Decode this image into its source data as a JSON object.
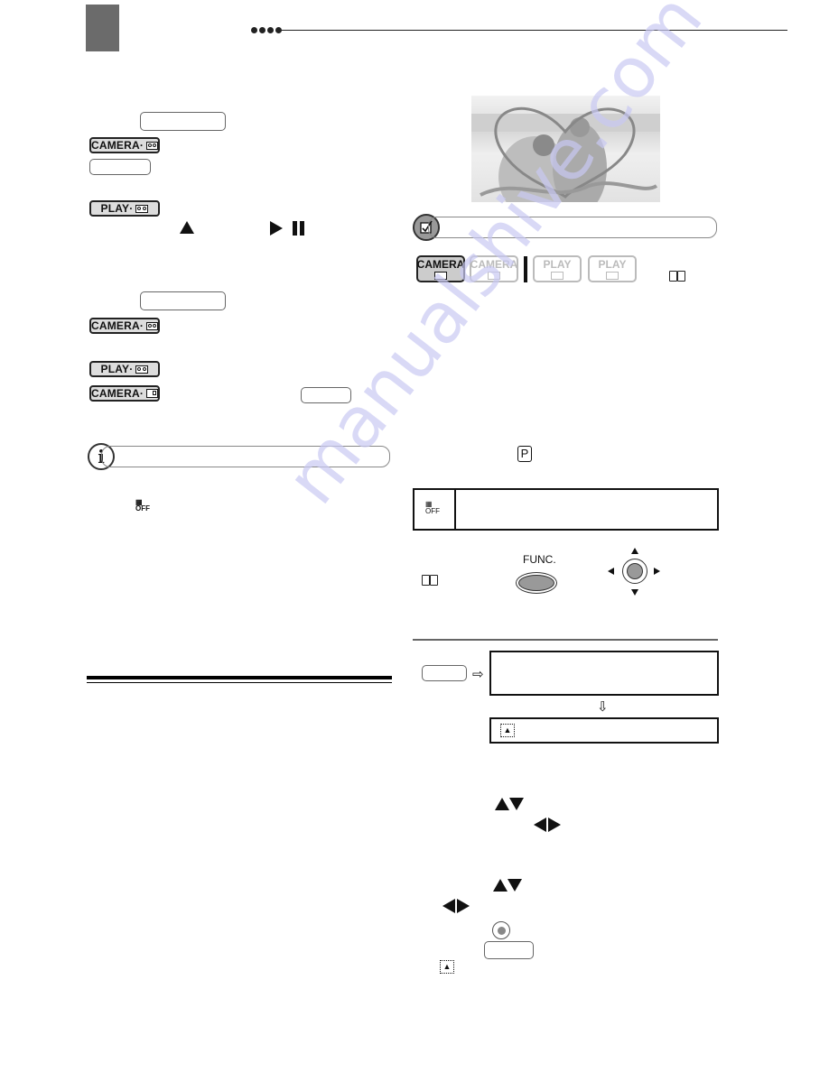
{
  "page": {
    "header": {
      "section_tab": "",
      "rule_style": "dots-and-line"
    },
    "watermark": "manualshive.com",
    "icons": {
      "mode_camera_tape": "CAMERA·",
      "mode_play_tape": "PLAY·",
      "mode_camera_card": "CAMERA·",
      "mode_big_camera": "CAMERA",
      "mode_big_play": "PLAY",
      "p_icon": "P",
      "func_label": "FUNC.",
      "off_icon": "OFF"
    },
    "mode_selector": [
      {
        "label": "CAMERA",
        "media": "tape",
        "active": true
      },
      {
        "label": "CAMERA",
        "media": "card",
        "active": false
      },
      {
        "label": "PLAY",
        "media": "tape",
        "active": false
      },
      {
        "label": "PLAY",
        "media": "card",
        "active": false
      }
    ],
    "accent": {
      "dark_gray": "#6b6b6b",
      "watermark": "#c9c9f3"
    }
  }
}
